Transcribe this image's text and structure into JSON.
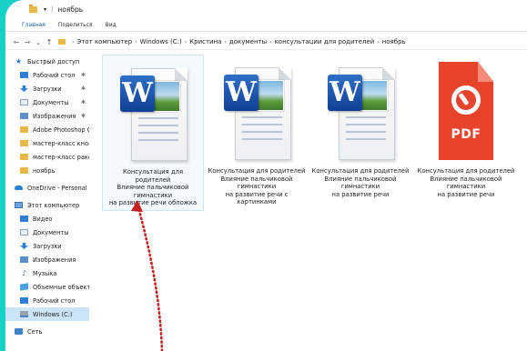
{
  "window": {
    "title": "ноябрь",
    "ribbon_tabs": [
      "Главная",
      "Поделиться",
      "Вид"
    ]
  },
  "address": {
    "crumbs": [
      "Этот компьютер",
      "Windows (C:)",
      "Кристина",
      "документы",
      "консультации для родителей",
      "ноябрь"
    ]
  },
  "sidebar": {
    "quick_access": "Быстрый доступ",
    "quick_items": [
      {
        "label": "Рабочий стол",
        "pinned": true
      },
      {
        "label": "Загрузки",
        "pinned": true
      },
      {
        "label": "Документы",
        "pinned": true
      },
      {
        "label": "Изображения",
        "pinned": true
      },
      {
        "label": "Adobe Photoshop C"
      },
      {
        "label": "мастер-класс кноа"
      },
      {
        "label": "мастер-класс раке"
      },
      {
        "label": "ноябрь"
      }
    ],
    "onedrive": "OneDrive - Personal",
    "this_pc": "Этот компьютер",
    "pc_items": [
      {
        "label": "Видео"
      },
      {
        "label": "Документы"
      },
      {
        "label": "Загрузки"
      },
      {
        "label": "Изображения"
      },
      {
        "label": "Музыка"
      },
      {
        "label": "Объемные объекты"
      },
      {
        "label": "Рабочий стол"
      },
      {
        "label": "Windows (C:)"
      }
    ],
    "network": "Сеть"
  },
  "files": [
    {
      "icon": "word-document-icon",
      "lines": [
        "Консультация для родителей",
        "Влияние пальчиковой гимнастики",
        "на развитие речи обложка"
      ]
    },
    {
      "icon": "word-document-icon",
      "lines": [
        "Консультация для родителей",
        "Влияние пальчиковой гимнастики",
        "на развитие речи с картинками"
      ]
    },
    {
      "icon": "word-document-icon",
      "lines": [
        "Консультация для родителей",
        "Влияние пальчиковой гимнастики",
        "на развитие речи"
      ]
    },
    {
      "icon": "pdf-document-icon",
      "badge": "PDF",
      "lines": [
        "Консультация для родителей",
        "Влияние пальчиковой гимнастики",
        "на развитие речи"
      ]
    }
  ],
  "colors": {
    "background": "#17d0c6",
    "annotation_arrow": "#c81e1e",
    "selection": "#cce4f7"
  }
}
